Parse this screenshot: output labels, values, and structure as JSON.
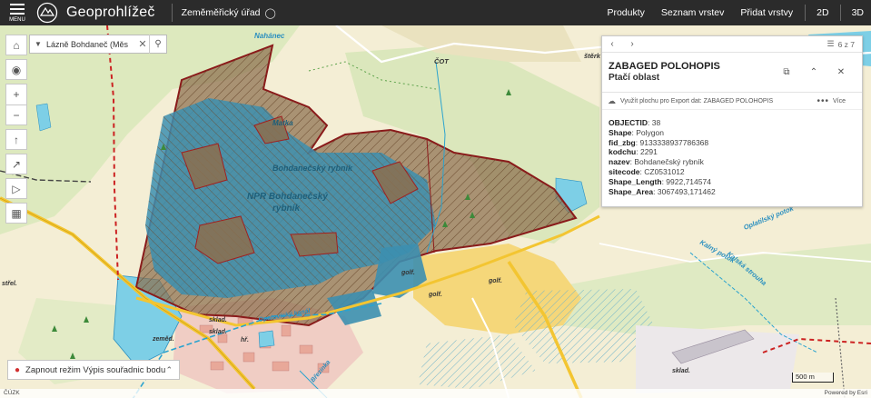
{
  "header": {
    "menu_label": "MENU",
    "app_title": "Geoprohlížeč",
    "agency": "Zeměměřický úřad",
    "nav": [
      "Produkty",
      "Seznam vrstev",
      "Přidat vrstvy"
    ],
    "views": [
      "2D",
      "3D"
    ],
    "icons": [
      "menu-icon",
      "logo-icon",
      "lightbulb-icon"
    ]
  },
  "search": {
    "value": "Lázně Bohdaneč (Měs",
    "icons": [
      "chevron-down-icon",
      "close-icon",
      "search-icon"
    ]
  },
  "toolbar": {
    "icons": [
      "home-icon",
      "locate-icon",
      "zoom-in-icon",
      "zoom-out-icon",
      "compass-icon",
      "export-icon",
      "megaphone-icon",
      "measure-icon"
    ]
  },
  "popup": {
    "counter": "6 z 7",
    "title": "ZABAGED POLOHOPIS",
    "subtitle": "Ptačí oblast",
    "action_text": "Využít plochu pro Export dat: ZABAGED POLOHOPIS",
    "more_label": "Více",
    "attributes": [
      {
        "key": "OBJECTID",
        "value": "38"
      },
      {
        "key": "Shape",
        "value": "Polygon"
      },
      {
        "key": "fid_zbg",
        "value": "9133338937786368"
      },
      {
        "key": "kodchu",
        "value": "2291"
      },
      {
        "key": "nazev",
        "value": "Bohdanečský rybník"
      },
      {
        "key": "sitecode",
        "value": "CZ0531012"
      },
      {
        "key": "Shape_Length",
        "value": "9922,714574"
      },
      {
        "key": "Shape_Area",
        "value": "3067493,171462"
      }
    ],
    "icons": [
      "chevron-left-icon",
      "chevron-right-icon",
      "list-icon",
      "dock-icon",
      "collapse-icon",
      "close-icon",
      "export-area-icon",
      "more-icon"
    ]
  },
  "coord_toggle": {
    "label": "Zapnout režim Výpis souřadnic bodu",
    "icons": [
      "location-pin-icon",
      "chevron-up-icon"
    ]
  },
  "scale": {
    "label": "500 m"
  },
  "attribution": {
    "left": "ČÚZK",
    "right": "Powered by Esri"
  },
  "map_labels": {
    "pond_main": "Bohdanečský rybník",
    "reserve_line1": "NPR Bohdanečský",
    "reserve_line2": "rybník",
    "matka": "Matka",
    "nahanec": "Nahánec",
    "cot": "ČOT",
    "sterk": "štěrk",
    "oplatil": "Oplatilský potok",
    "kalny": "Kalný potok",
    "strouha": "Kalská strouha",
    "golf1": "golf.",
    "golf2": "golf.",
    "golf3": "golf.",
    "sklad1": "sklad.",
    "sklad2": "sklad.",
    "sklad3": "sklad.",
    "zemed": "zeměd.",
    "hr": "hř.",
    "strel": "střel.",
    "kanal": "Opatovický kanál",
    "brezinka": "Březinka"
  },
  "colors": {
    "header_bg": "#2b2b2b",
    "reserve_fill": "#8c6f4e",
    "water": "#7dcfe6",
    "water_blue": "#3c8fb0",
    "border_red": "#cc2222",
    "road_yellow": "#f3c531"
  }
}
